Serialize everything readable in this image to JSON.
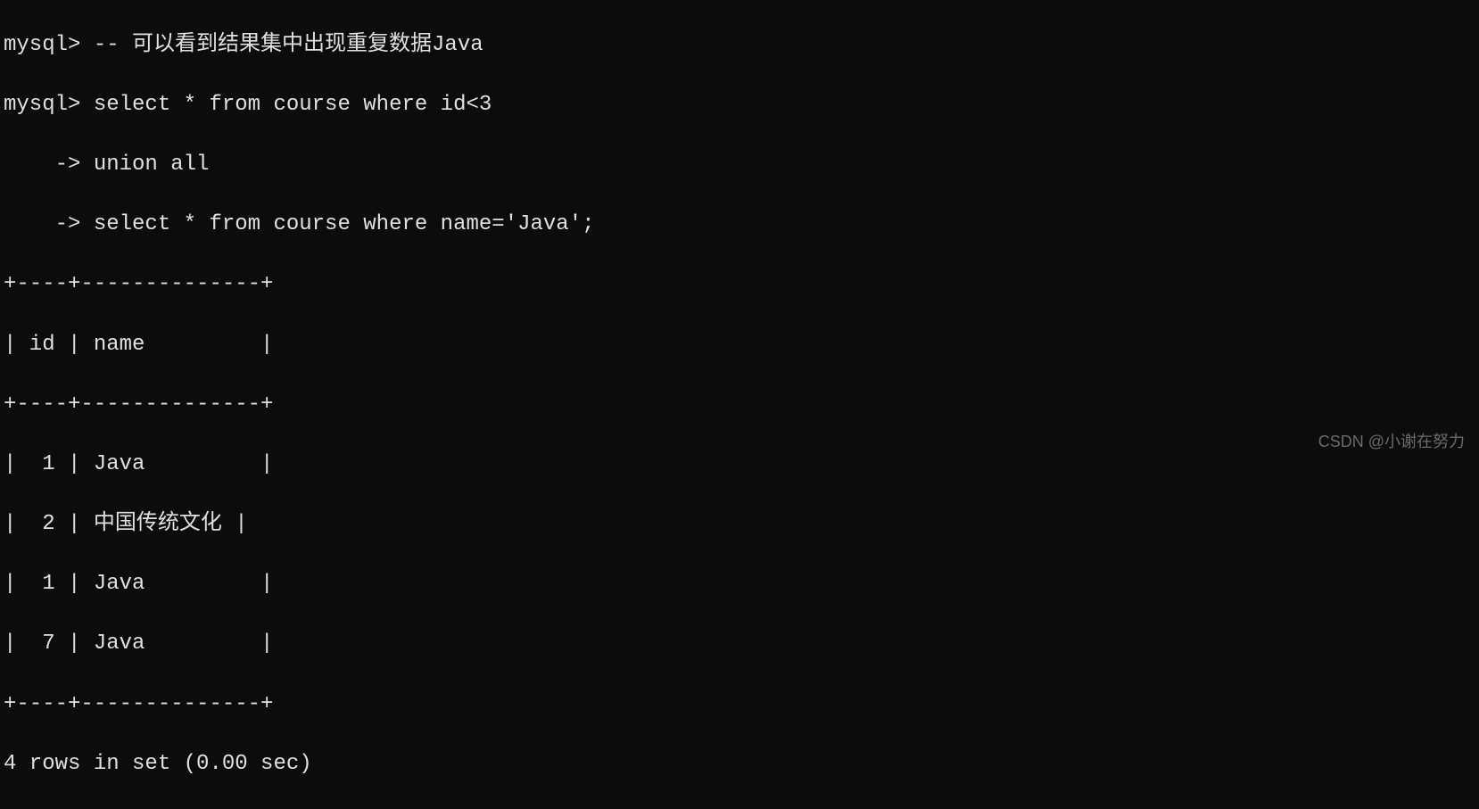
{
  "terminal": {
    "lines": [
      "mysql> -- 可以看到结果集中出现重复数据Java",
      "mysql> select * from course where id<3",
      "    -> union all",
      "    -> select * from course where name='Java';",
      "+----+--------------+",
      "| id | name         |",
      "+----+--------------+",
      "|  1 | Java         |",
      "|  2 | 中国传统文化 |",
      "|  1 | Java         |",
      "|  7 | Java         |",
      "+----+--------------+",
      "4 rows in set (0.00 sec)"
    ]
  },
  "sql": {
    "comment": "-- 可以看到结果集中出现重复数据Java",
    "query": "select * from course where id<3 union all select * from course where name='Java';"
  },
  "result_table": {
    "columns": [
      "id",
      "name"
    ],
    "rows": [
      {
        "id": 1,
        "name": "Java"
      },
      {
        "id": 2,
        "name": "中国传统文化"
      },
      {
        "id": 1,
        "name": "Java"
      },
      {
        "id": 7,
        "name": "Java"
      }
    ],
    "summary": "4 rows in set (0.00 sec)"
  },
  "watermark": "CSDN @小谢在努力"
}
